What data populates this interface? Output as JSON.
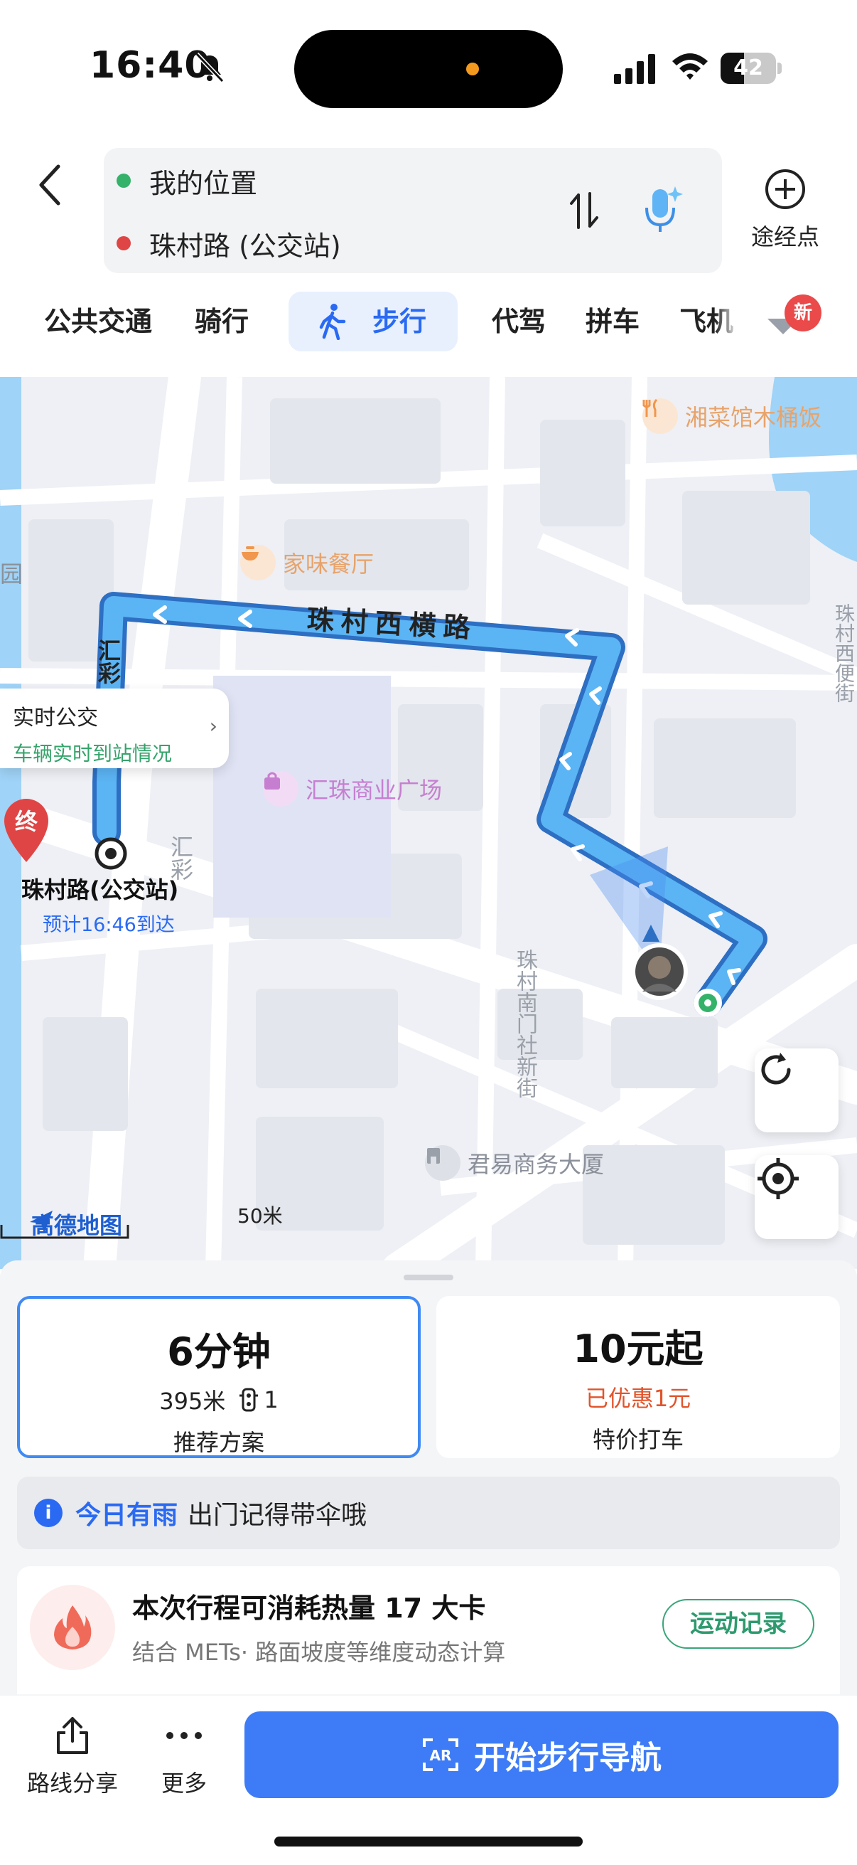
{
  "status_bar": {
    "time": "16:40",
    "battery": "42",
    "battery_level": 0.42
  },
  "route": {
    "from": "我的位置",
    "to": "珠村路 (公交站)",
    "waypoint_label": "途经点"
  },
  "modes": {
    "items": [
      "公共交通",
      "骑行",
      "步行",
      "代驾",
      "拼车",
      "飞机"
    ],
    "active": "步行",
    "new_badge": "新"
  },
  "map": {
    "road_label": "珠村西横路",
    "poi_hunan": "湘菜馆木桶饭",
    "poi_jiawei": "家味餐厅",
    "poi_mall": "汇珠商业广场",
    "poi_building": "君易商务大厦",
    "side_road_1": "汇彩",
    "side_road_2": "汇彩",
    "side_road_south": "珠村南门社新街",
    "side_road_east": "珠村西便街",
    "edge_label": "园",
    "callout_title": "实时公交",
    "callout_sub": "车辆实时到站情况",
    "end_marker": "终",
    "end_name": "珠村路(公交站)",
    "end_eta": "预计16:46到达",
    "scale": "50米",
    "logo": "高德地图"
  },
  "plans": {
    "primary": {
      "time": "6分钟",
      "distance": "395米",
      "lights": "1",
      "tag": "推荐方案"
    },
    "secondary": {
      "price": "10元起",
      "discount": "已优惠1元",
      "tag": "特价打车"
    }
  },
  "weather": {
    "title": "今日有雨",
    "text": "出门记得带伞哦"
  },
  "calories": {
    "title": "本次行程可消耗热量 17 大卡",
    "subtitle": "结合 METs· 路面坡度等维度动态计算",
    "button": "运动记录"
  },
  "actions": {
    "share": "路线分享",
    "more": "更多",
    "start": "开始步行导航"
  },
  "colors": {
    "accent": "#3d7cf6",
    "route": "#3d8fe6",
    "start_dot": "#35b26a",
    "end_dot": "#e04545"
  }
}
